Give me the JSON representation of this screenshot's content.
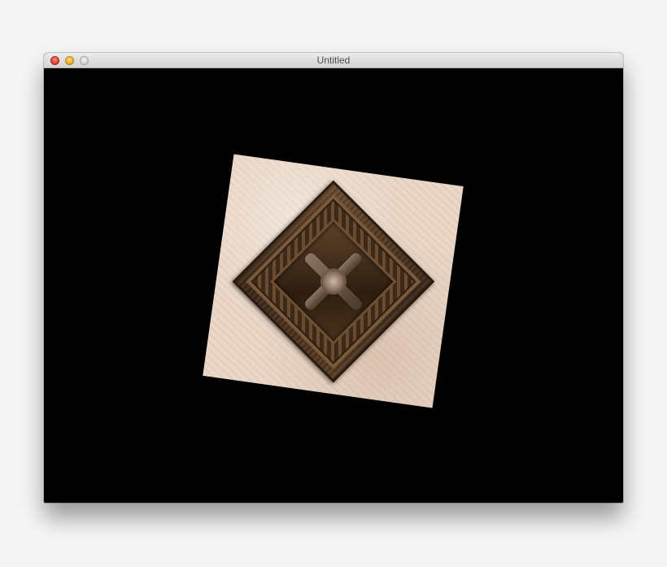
{
  "window": {
    "title": "Untitled",
    "controls": {
      "close": "close-button",
      "minimize": "minimize-button",
      "zoom": "zoom-button"
    }
  },
  "canvas": {
    "background": "#000000",
    "content": "rotated-textured-quad",
    "texture_colors": {
      "plaster": "#ead7c8",
      "wood": "#4a331e"
    }
  }
}
